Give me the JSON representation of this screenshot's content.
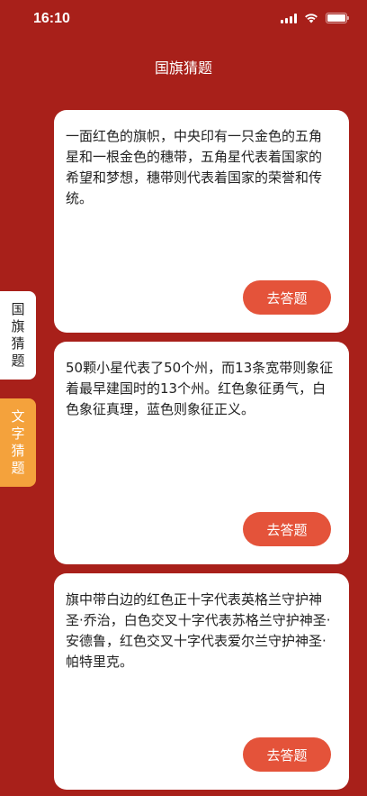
{
  "status": {
    "time": "16:10"
  },
  "nav": {
    "title": "国旗猜题"
  },
  "side_tabs": [
    {
      "chars": [
        "国",
        "旗",
        "猜",
        "题"
      ],
      "active": true
    },
    {
      "chars": [
        "文",
        "字",
        "猜",
        "题"
      ],
      "active": false
    }
  ],
  "cards": [
    {
      "text": "一面红色的旗帜，中央印有一只金色的五角星和一根金色的穗带，五角星代表着国家的希望和梦想，穗带则代表着国家的荣誉和传统。",
      "button": "去答题"
    },
    {
      "text": "50颗小星代表了50个州，而13条宽带则象征着最早建国时的13个州。红色象征勇气，白色象征真理，蓝色则象征正义。",
      "button": "去答题"
    },
    {
      "text": "旗中带白边的红色正十字代表英格兰守护神圣·乔治，白色交叉十字代表苏格兰守护神圣·安德鲁，红色交叉十字代表爱尔兰守护神圣·帕特里克。",
      "button": "去答题"
    }
  ],
  "colors": {
    "background": "#a8201a",
    "button": "#e4533a",
    "active_tab": "#ffffff",
    "inactive_tab": "#f4a23c"
  }
}
